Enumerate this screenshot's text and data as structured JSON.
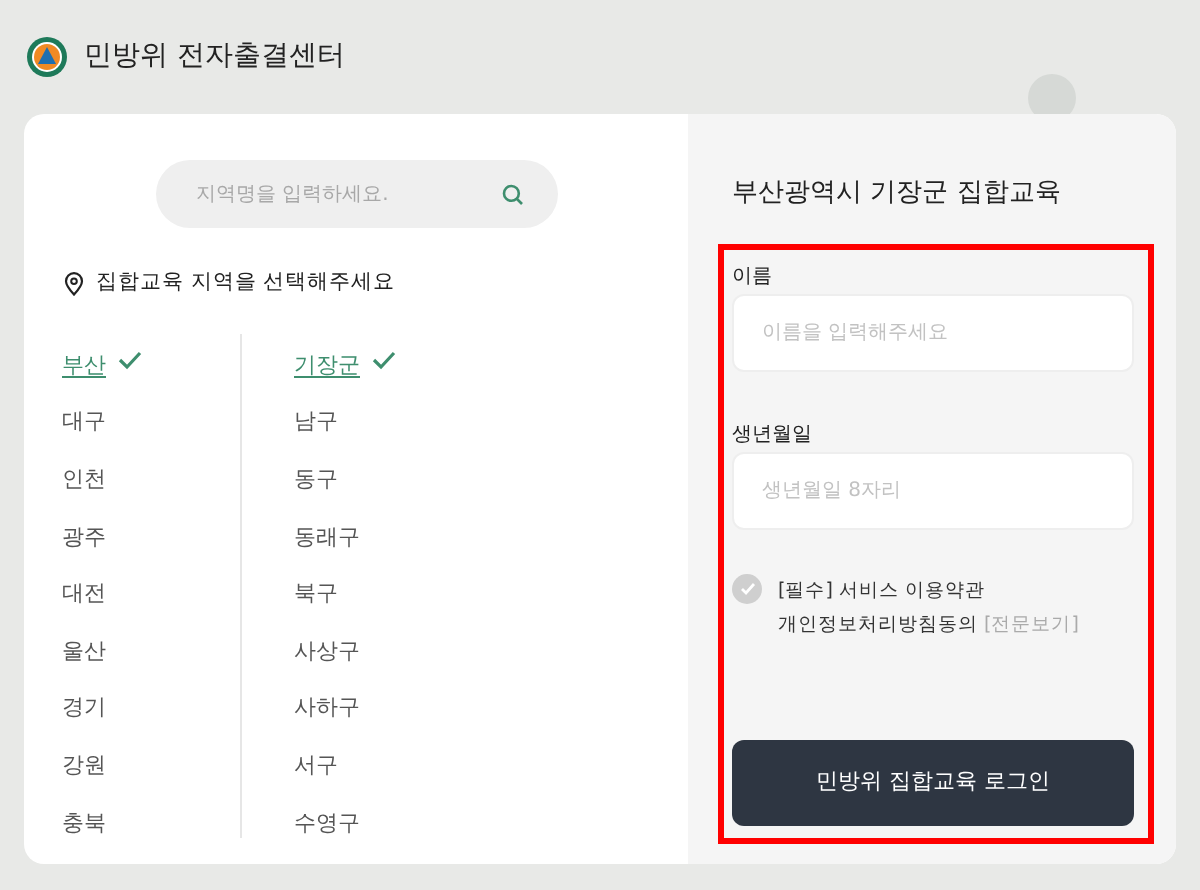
{
  "header": {
    "title": "민방위 전자출결센터"
  },
  "search": {
    "placeholder": "지역명을 입력하세요."
  },
  "hint": "집합교육 지역을 선택해주세요",
  "cities": [
    {
      "label": "부산",
      "selected": true
    },
    {
      "label": "대구",
      "selected": false
    },
    {
      "label": "인천",
      "selected": false
    },
    {
      "label": "광주",
      "selected": false
    },
    {
      "label": "대전",
      "selected": false
    },
    {
      "label": "울산",
      "selected": false
    },
    {
      "label": "경기",
      "selected": false
    },
    {
      "label": "강원",
      "selected": false
    },
    {
      "label": "충북",
      "selected": false
    }
  ],
  "districts": [
    {
      "label": "기장군",
      "selected": true
    },
    {
      "label": "남구",
      "selected": false
    },
    {
      "label": "동구",
      "selected": false
    },
    {
      "label": "동래구",
      "selected": false
    },
    {
      "label": "북구",
      "selected": false
    },
    {
      "label": "사상구",
      "selected": false
    },
    {
      "label": "사하구",
      "selected": false
    },
    {
      "label": "서구",
      "selected": false
    },
    {
      "label": "수영구",
      "selected": false
    }
  ],
  "form": {
    "title": "부산광역시 기장군 집합교육",
    "fields": [
      {
        "label": "이름",
        "placeholder": "이름을 입력해주세요"
      },
      {
        "label": "생년월일",
        "placeholder": "생년월일 8자리"
      }
    ],
    "agreement": {
      "checked": false,
      "tag": "[필수]",
      "line_1": "서비스 이용약관",
      "line_2": "개인정보처리방침동의",
      "link": "[전문보기]"
    },
    "submit": "민방위 집합교육 로그인"
  }
}
